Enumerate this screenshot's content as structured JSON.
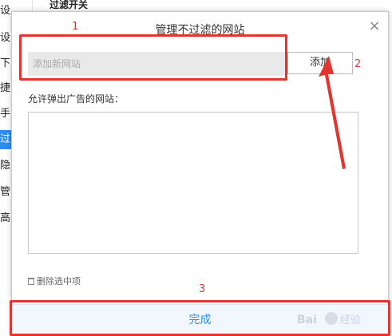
{
  "background": {
    "header": "过滤开关",
    "sidebar": [
      "设置",
      "设",
      "下",
      "捷",
      "手",
      "过",
      "隐",
      "管",
      "高"
    ],
    "active_index": 5
  },
  "dialog": {
    "title": "管理不过滤的网站",
    "close_glyph": "×",
    "input": {
      "placeholder": "添加新网站",
      "value": ""
    },
    "add_label": "添加",
    "list_label": "允许弹出广告的网站：",
    "sites": [],
    "delete_label": "删除选中项",
    "done_label": "完成"
  },
  "annotations": {
    "n1": "1",
    "n2": "2",
    "n3": "3"
  },
  "colors": {
    "accent": "#2d8cf0",
    "annotation": "#e3342f"
  }
}
